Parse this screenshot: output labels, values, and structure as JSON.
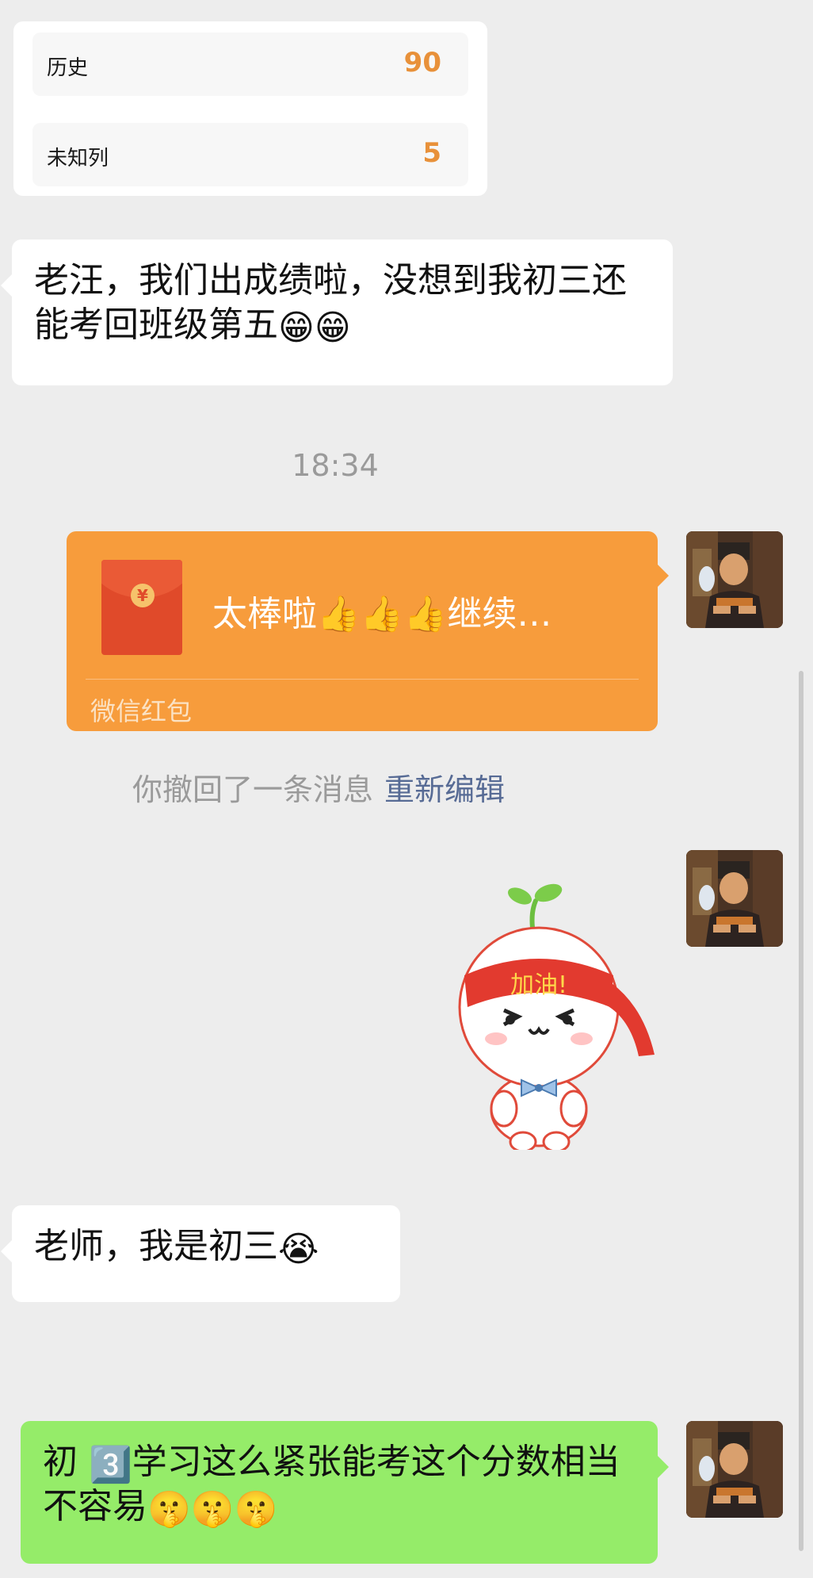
{
  "scores": [
    {
      "subject": "历史",
      "score": "90"
    },
    {
      "subject": "未知列",
      "score": "5"
    }
  ],
  "messages": {
    "student1": {
      "text": "老汪，我们出成绩啦，没想到我初三还能考回班级第五",
      "emojis": [
        "😁",
        "😁"
      ]
    },
    "timestamp": "18:34",
    "red_packet": {
      "text": "太棒啦👍👍👍继续…",
      "footer": "微信红包",
      "coin": "¥"
    },
    "recall": {
      "text": "你撤回了一条消息",
      "action": "重新编辑"
    },
    "sticker": {
      "headband": "加油!"
    },
    "student2": {
      "text": "老师，我是初三",
      "emoji": "😭"
    },
    "teacher_reply": {
      "prefix": "初",
      "keycap": "3️⃣",
      "text": "学习这么紧张能考这个分数相当不容易",
      "emojis": [
        "🤫",
        "🤫",
        "🤫"
      ]
    }
  },
  "colors": {
    "chat_background": "#ededed",
    "green_bubble": "#95ec69",
    "red_packet": "#f79c3c",
    "score": "#e8913a",
    "link": "#576b95"
  }
}
